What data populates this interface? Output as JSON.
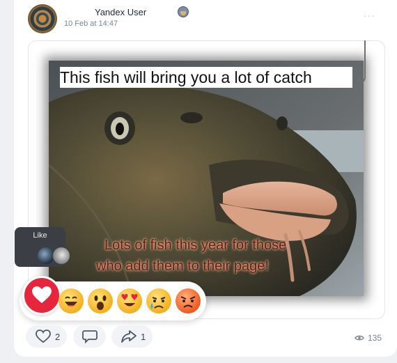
{
  "post": {
    "author": "Yandex User",
    "date": "10 Feb at 14:47",
    "more_icon": "more-dots-icon",
    "image": {
      "top_caption": "This fish will bring you a lot of catch",
      "bottom_caption_line1": "Lots of fish this year for those",
      "bottom_caption_line2": "who add them to their page!"
    }
  },
  "like_tooltip": {
    "label": "Like"
  },
  "reactions": {
    "items": [
      "heart",
      "laughing",
      "surprised",
      "love-eyes",
      "crying",
      "angry"
    ],
    "accent": "#e6263c"
  },
  "actions": {
    "like_count": "2",
    "comment_icon": "comment-icon",
    "share_count": "1",
    "views_count": "135"
  },
  "colors": {
    "accent": "#e6263c",
    "muted": "#7b8493",
    "pill": "#f2f3f6"
  }
}
